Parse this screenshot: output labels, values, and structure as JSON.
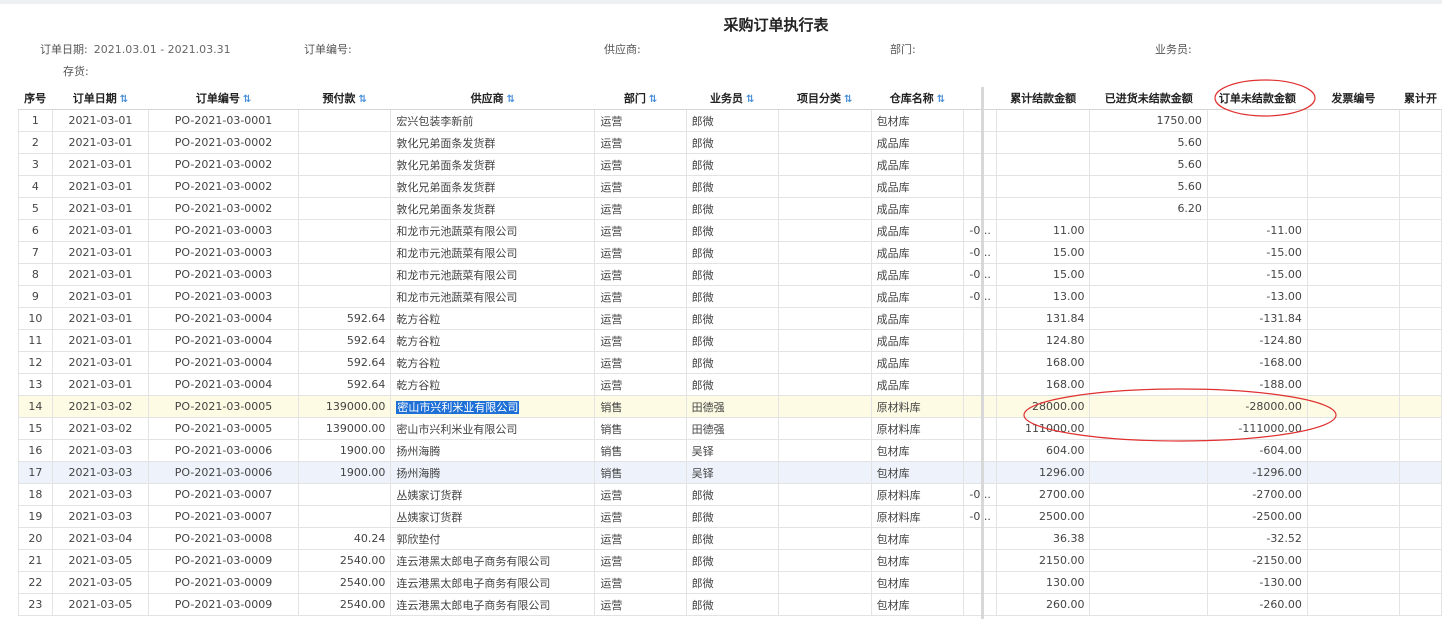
{
  "report": {
    "title": "采购订单执行表",
    "filters": {
      "order_date_label": "订单日期:",
      "order_date_value": "2021.03.01 - 2021.03.31",
      "order_no_label": "订单编号:",
      "supplier_label": "供应商:",
      "dept_label": "部门:",
      "salesman_label": "业务员:",
      "stock_label": "存货:"
    }
  },
  "table": {
    "columns": [
      {
        "label": "序号",
        "sortable": false
      },
      {
        "label": "订单日期",
        "sortable": true
      },
      {
        "label": "订单编号",
        "sortable": true
      },
      {
        "label": "预付款",
        "sortable": true
      },
      {
        "label": "供应商",
        "sortable": true
      },
      {
        "label": "部门",
        "sortable": true
      },
      {
        "label": "业务员",
        "sortable": true
      },
      {
        "label": "项目分类",
        "sortable": true
      },
      {
        "label": "仓库名称",
        "sortable": true
      },
      {
        "label": "",
        "sortable": false
      },
      {
        "label": "累计结款金额",
        "sortable": false
      },
      {
        "label": "已进货未结款金额",
        "sortable": false
      },
      {
        "label": "订单未结款金额",
        "sortable": false
      },
      {
        "label": "发票编号",
        "sortable": false
      },
      {
        "label": "累计开",
        "sortable": false
      }
    ],
    "rows": [
      [
        "1",
        "2021-03-01",
        "PO-2021-03-0001",
        "",
        "宏兴包装李新前",
        "运营",
        "郎微",
        "",
        "包材库",
        "",
        "",
        "1750.00",
        "",
        "",
        ""
      ],
      [
        "2",
        "2021-03-01",
        "PO-2021-03-0002",
        "",
        "敦化兄弟面条发货群",
        "运营",
        "郎微",
        "",
        "成品库",
        "",
        "",
        "5.60",
        "",
        "",
        ""
      ],
      [
        "3",
        "2021-03-01",
        "PO-2021-03-0002",
        "",
        "敦化兄弟面条发货群",
        "运营",
        "郎微",
        "",
        "成品库",
        "",
        "",
        "5.60",
        "",
        "",
        ""
      ],
      [
        "4",
        "2021-03-01",
        "PO-2021-03-0002",
        "",
        "敦化兄弟面条发货群",
        "运营",
        "郎微",
        "",
        "成品库",
        "",
        "",
        "5.60",
        "",
        "",
        ""
      ],
      [
        "5",
        "2021-03-01",
        "PO-2021-03-0002",
        "",
        "敦化兄弟面条发货群",
        "运营",
        "郎微",
        "",
        "成品库",
        "",
        "",
        "6.20",
        "",
        "",
        ""
      ],
      [
        "6",
        "2021-03-01",
        "PO-2021-03-0003",
        "",
        "和龙市元池蔬菜有限公司",
        "运营",
        "郎微",
        "",
        "成品库",
        "-0...",
        "11.00",
        "",
        "-11.00",
        "",
        ""
      ],
      [
        "7",
        "2021-03-01",
        "PO-2021-03-0003",
        "",
        "和龙市元池蔬菜有限公司",
        "运营",
        "郎微",
        "",
        "成品库",
        "-0...",
        "15.00",
        "",
        "-15.00",
        "",
        ""
      ],
      [
        "8",
        "2021-03-01",
        "PO-2021-03-0003",
        "",
        "和龙市元池蔬菜有限公司",
        "运营",
        "郎微",
        "",
        "成品库",
        "-0...",
        "15.00",
        "",
        "-15.00",
        "",
        ""
      ],
      [
        "9",
        "2021-03-01",
        "PO-2021-03-0003",
        "",
        "和龙市元池蔬菜有限公司",
        "运营",
        "郎微",
        "",
        "成品库",
        "-0...",
        "13.00",
        "",
        "-13.00",
        "",
        ""
      ],
      [
        "10",
        "2021-03-01",
        "PO-2021-03-0004",
        "592.64",
        "乾方谷粒",
        "运营",
        "郎微",
        "",
        "成品库",
        "",
        "131.84",
        "",
        "-131.84",
        "",
        ""
      ],
      [
        "11",
        "2021-03-01",
        "PO-2021-03-0004",
        "592.64",
        "乾方谷粒",
        "运营",
        "郎微",
        "",
        "成品库",
        "",
        "124.80",
        "",
        "-124.80",
        "",
        ""
      ],
      [
        "12",
        "2021-03-01",
        "PO-2021-03-0004",
        "592.64",
        "乾方谷粒",
        "运营",
        "郎微",
        "",
        "成品库",
        "",
        "168.00",
        "",
        "-168.00",
        "",
        ""
      ],
      [
        "13",
        "2021-03-01",
        "PO-2021-03-0004",
        "592.64",
        "乾方谷粒",
        "运营",
        "郎微",
        "",
        "成品库",
        "",
        "168.00",
        "",
        "-188.00",
        "",
        ""
      ],
      [
        "14",
        "2021-03-02",
        "PO-2021-03-0005",
        "139000.00",
        "密山市兴利米业有限公司",
        "销售",
        "田德强",
        "",
        "原材料库",
        "",
        "28000.00",
        "",
        "-28000.00",
        "",
        ""
      ],
      [
        "15",
        "2021-03-02",
        "PO-2021-03-0005",
        "139000.00",
        "密山市兴利米业有限公司",
        "销售",
        "田德强",
        "",
        "原材料库",
        "",
        "111000.00",
        "",
        "-111000.00",
        "",
        ""
      ],
      [
        "16",
        "2021-03-03",
        "PO-2021-03-0006",
        "1900.00",
        "扬州海腾",
        "销售",
        "吴铎",
        "",
        "包材库",
        "",
        "604.00",
        "",
        "-604.00",
        "",
        ""
      ],
      [
        "17",
        "2021-03-03",
        "PO-2021-03-0006",
        "1900.00",
        "扬州海腾",
        "销售",
        "吴铎",
        "",
        "包材库",
        "",
        "1296.00",
        "",
        "-1296.00",
        "",
        ""
      ],
      [
        "18",
        "2021-03-03",
        "PO-2021-03-0007",
        "",
        "丛姨家订货群",
        "运营",
        "郎微",
        "",
        "原材料库",
        "-0...",
        "2700.00",
        "",
        "-2700.00",
        "",
        ""
      ],
      [
        "19",
        "2021-03-03",
        "PO-2021-03-0007",
        "",
        "丛姨家订货群",
        "运营",
        "郎微",
        "",
        "原材料库",
        "-0...",
        "2500.00",
        "",
        "-2500.00",
        "",
        ""
      ],
      [
        "20",
        "2021-03-04",
        "PO-2021-03-0008",
        "40.24",
        "郭欣垫付",
        "运营",
        "郎微",
        "",
        "包材库",
        "",
        "36.38",
        "",
        "-32.52",
        "",
        ""
      ],
      [
        "21",
        "2021-03-05",
        "PO-2021-03-0009",
        "2540.00",
        "连云港黑太郎电子商务有限公司",
        "运营",
        "郎微",
        "",
        "包材库",
        "",
        "2150.00",
        "",
        "-2150.00",
        "",
        ""
      ],
      [
        "22",
        "2021-03-05",
        "PO-2021-03-0009",
        "2540.00",
        "连云港黑太郎电子商务有限公司",
        "运营",
        "郎微",
        "",
        "包材库",
        "",
        "130.00",
        "",
        "-130.00",
        "",
        ""
      ],
      [
        "23",
        "2021-03-05",
        "PO-2021-03-0009",
        "2540.00",
        "连云港黑太郎电子商务有限公司",
        "运营",
        "郎微",
        "",
        "包材库",
        "",
        "260.00",
        "",
        "-260.00",
        "",
        ""
      ]
    ],
    "selected_row": 14,
    "alt_row": 17,
    "highlighted_cell": {
      "row": 14,
      "col": 4
    }
  },
  "annotation_color": "#e03030"
}
